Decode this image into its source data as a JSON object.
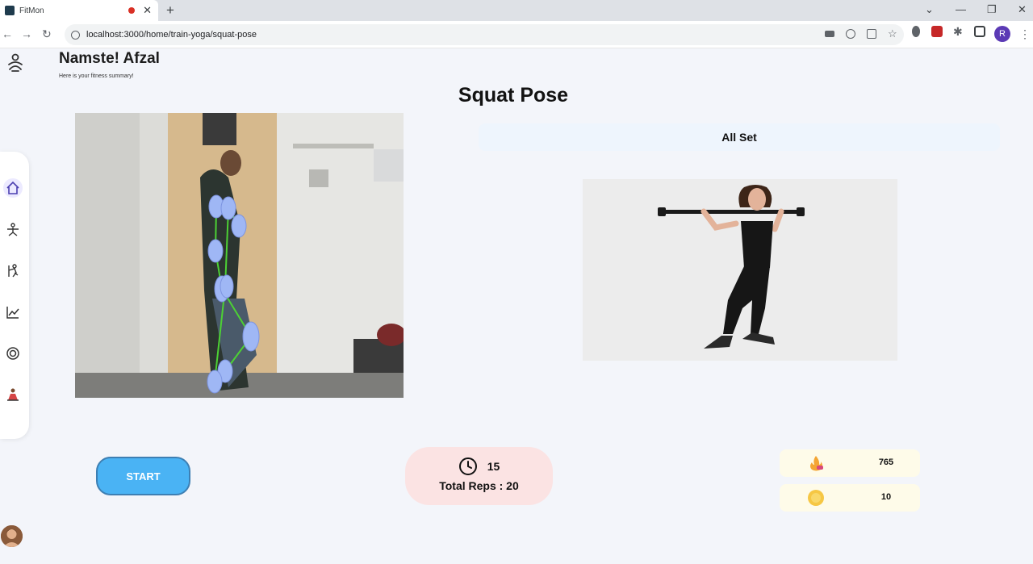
{
  "browser": {
    "tab_title": "FitMon",
    "url": "localhost:3000/home/train-yoga/squat-pose",
    "profile_initial": "R"
  },
  "app": {
    "greeting": "Namste! Afzal",
    "subtitle": "Here is your fitness summary!",
    "page_title": "Squat Pose",
    "status_text": "All Set",
    "start_label": "START",
    "timer_value": "15",
    "total_reps": "Total Reps : 20",
    "calories_value": "765",
    "coins_value": "10"
  },
  "sidebar": {
    "items": [
      "home-icon",
      "yoga-icon",
      "exercise-icon",
      "stats-icon",
      "target-icon",
      "meditation-icon"
    ],
    "active": "home-icon"
  },
  "colors": {
    "start_button": "#4ab3f4",
    "timer_bg": "#fbe3e3",
    "status_bg": "#eef5fd",
    "stat_bg": "#fefbe9",
    "skeleton_joint": "#9fb7f5",
    "skeleton_line": "#4cd134"
  }
}
